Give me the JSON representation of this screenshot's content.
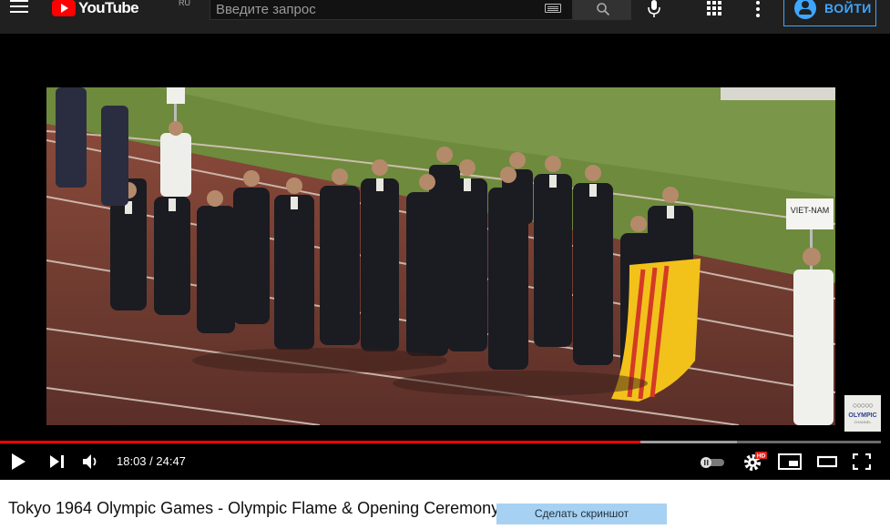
{
  "header": {
    "logo_text": "YouTube",
    "logo_region": "RU",
    "search": {
      "placeholder": "Введите запрос",
      "value": ""
    },
    "signin_label": "ВОЙТИ",
    "accent_color": "#3ea6ff",
    "icons": [
      "menu-icon",
      "keyboard-icon",
      "search-icon",
      "mic-icon",
      "apps-icon",
      "more-vert-icon",
      "account-icon"
    ]
  },
  "player": {
    "current_time": "18:03",
    "duration": "24:47",
    "time_display": "18:03 / 24:47",
    "played_fraction": 0.7274,
    "buffered_fraction": 0.8364,
    "hd_badge": "HD",
    "watermark": {
      "rings": "○○○○○",
      "name": "OLYMPIC",
      "sub": "CHANNEL"
    },
    "scene_sign": "VIET-NAM",
    "progress_color": "#ff0000"
  },
  "video": {
    "title": "Tokyo 1964 Olympic Games - Olympic Flame & Opening Ceremony"
  },
  "extension": {
    "screenshot_label": "Сделать скриншот"
  }
}
